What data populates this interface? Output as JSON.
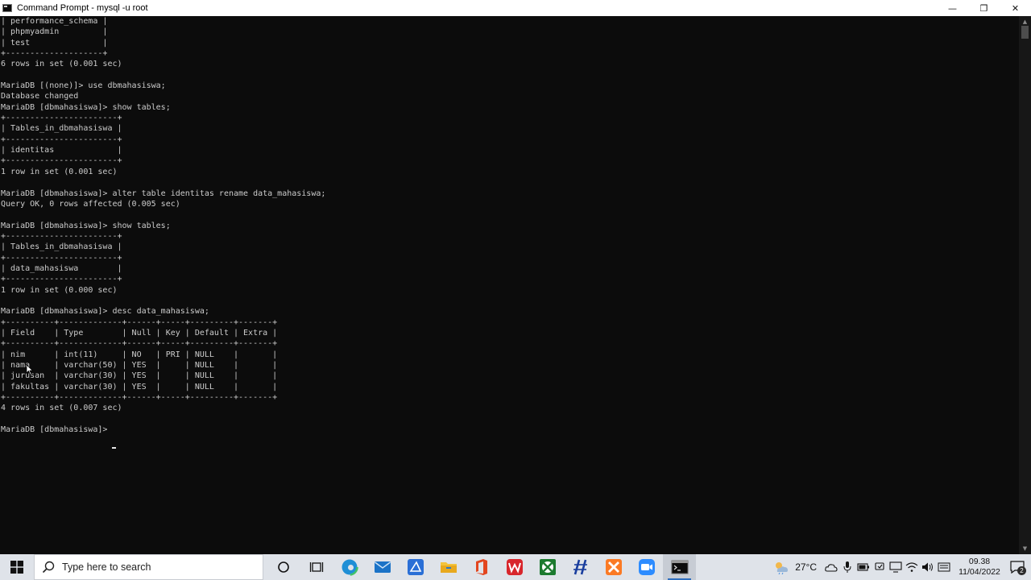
{
  "window": {
    "title": "Command Prompt - mysql  -u root",
    "controls": {
      "minimize": "—",
      "maximize": "❐",
      "close": "✕"
    }
  },
  "console": {
    "lines": [
      "| performance_schema |",
      "| phpmyadmin         |",
      "| test               |",
      "+--------------------+",
      "6 rows in set (0.001 sec)",
      "",
      "MariaDB [(none)]> use dbmahasiswa;",
      "Database changed",
      "MariaDB [dbmahasiswa]> show tables;",
      "+-----------------------+",
      "| Tables_in_dbmahasiswa |",
      "+-----------------------+",
      "| identitas             |",
      "+-----------------------+",
      "1 row in set (0.001 sec)",
      "",
      "MariaDB [dbmahasiswa]> alter table identitas rename data_mahasiswa;",
      "Query OK, 0 rows affected (0.005 sec)",
      "",
      "MariaDB [dbmahasiswa]> show tables;",
      "+-----------------------+",
      "| Tables_in_dbmahasiswa |",
      "+-----------------------+",
      "| data_mahasiswa        |",
      "+-----------------------+",
      "1 row in set (0.000 sec)",
      "",
      "MariaDB [dbmahasiswa]> desc data_mahasiswa;",
      "+----------+-------------+------+-----+---------+-------+",
      "| Field    | Type        | Null | Key | Default | Extra |",
      "+----------+-------------+------+-----+---------+-------+",
      "| nim      | int(11)     | NO   | PRI | NULL    |       |",
      "| nama     | varchar(50) | YES  |     | NULL    |       |",
      "| jurusan  | varchar(30) | YES  |     | NULL    |       |",
      "| fakultas | varchar(30) | YES  |     | NULL    |       |",
      "+----------+-------------+------+-----+---------+-------+",
      "4 rows in set (0.007 sec)",
      "",
      "MariaDB [dbmahasiswa]> "
    ]
  },
  "taskbar": {
    "search_placeholder": "Type here to search",
    "apps": [
      {
        "name": "cortana-icon"
      },
      {
        "name": "task-view-icon"
      },
      {
        "name": "edge-icon"
      },
      {
        "name": "mail-icon"
      },
      {
        "name": "azure-data-icon"
      },
      {
        "name": "file-explorer-icon"
      },
      {
        "name": "office-icon"
      },
      {
        "name": "wps-icon"
      },
      {
        "name": "xbox-icon"
      },
      {
        "name": "slash-app-icon"
      },
      {
        "name": "xampp-icon"
      },
      {
        "name": "zoom-icon"
      },
      {
        "name": "command-prompt-icon"
      }
    ],
    "temperature": "27°C",
    "time": "09.38",
    "date": "11/04/2022",
    "notification_count": "2"
  },
  "colors": {
    "console_bg": "#0c0c0c",
    "console_text": "#cccccc",
    "taskbar_bg": "#dfe3e9",
    "accent": "#2f6fbf"
  }
}
